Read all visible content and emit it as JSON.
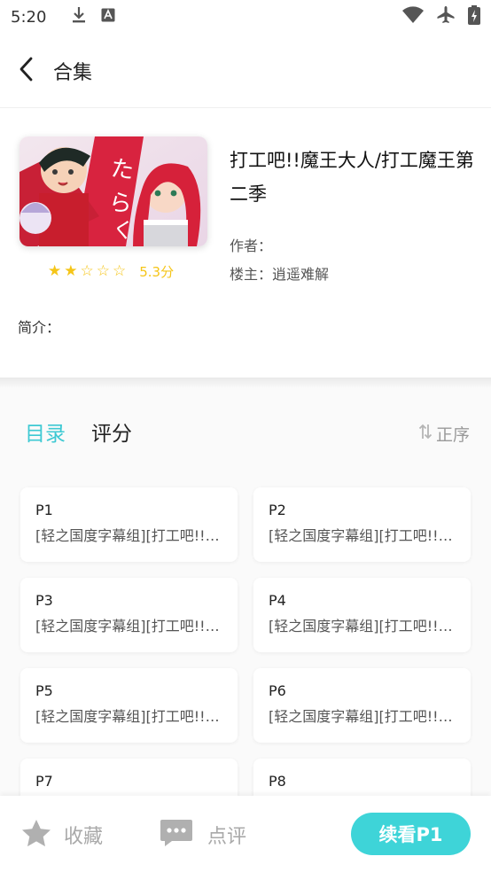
{
  "status_bar": {
    "time": "5:20",
    "icons_left": [
      "download-icon",
      "text-app-icon"
    ],
    "icons_right": [
      "wifi-icon",
      "airplane-icon",
      "battery-icon"
    ]
  },
  "header": {
    "title": "合集",
    "back_icon": "chevron-left-icon"
  },
  "info": {
    "title": "打工吧!!魔王大人/打工魔王第二季",
    "author_label": "作者：",
    "owner_label": "楼主：逍遥难解",
    "rating_stars_filled": 2,
    "rating_stars_total": 5,
    "rating_score": "5.3分",
    "intro_label": "简介："
  },
  "tabs": {
    "items": [
      {
        "label": "目录",
        "active": true
      },
      {
        "label": "评分",
        "active": false
      }
    ],
    "sort_label": "正序",
    "sort_icon": "sort-arrows-icon"
  },
  "episodes": [
    {
      "name": "P1",
      "desc": "[轻之国度字幕组][打工吧!!魔王大人]"
    },
    {
      "name": "P2",
      "desc": "[轻之国度字幕组][打工吧!!魔王大人]"
    },
    {
      "name": "P3",
      "desc": "[轻之国度字幕组][打工吧!!魔王大人]"
    },
    {
      "name": "P4",
      "desc": "[轻之国度字幕组][打工吧!!魔王大人]"
    },
    {
      "name": "P5",
      "desc": "[轻之国度字幕组][打工吧!!魔王大人]"
    },
    {
      "name": "P6",
      "desc": "[轻之国度字幕组][打工吧!!魔王大人]"
    },
    {
      "name": "P7",
      "desc": ""
    },
    {
      "name": "P8",
      "desc": ""
    }
  ],
  "bottom_bar": {
    "favorite_label": "收藏",
    "comment_label": "点评",
    "continue_label": "续看P1",
    "accent_color": "#3ed4d8"
  },
  "colors": {
    "accent": "#3ec9d3",
    "star": "#f5c518"
  }
}
